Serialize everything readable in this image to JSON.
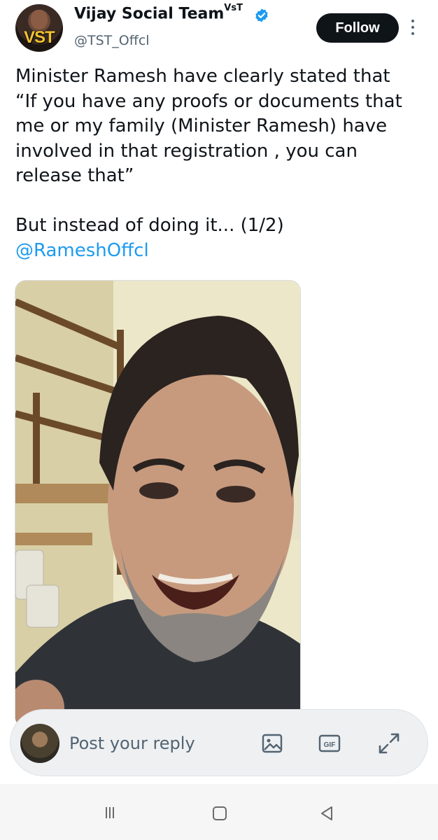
{
  "author": {
    "display_name": "Vijay Social Team",
    "name_superscript": "VsT",
    "handle": "@TST_Offcl",
    "avatar_text": "VST",
    "verified": true
  },
  "actions": {
    "follow_label": "Follow"
  },
  "tweet": {
    "lines": [
      "Minister Ramesh have clearly stated that",
      "“If you have any proofs or documents that",
      "me or my family (Minister Ramesh) have",
      "involved in that registration , you can",
      "release that”"
    ],
    "second_paragraph": "But instead of doing it... (1/2)",
    "mention": "@RameshOffcl"
  },
  "media": {
    "type": "video",
    "description_icon": "person-photo"
  },
  "reply": {
    "placeholder": "Post your reply"
  },
  "colors": {
    "link": "#1d9bf0",
    "verified_badge": "#1d9bf0",
    "follow_bg": "#0f1419",
    "secondary_text": "#536471"
  },
  "icons": {
    "verified": "verified-badge-icon",
    "more": "more-vertical-icon",
    "image": "image-icon",
    "gif": "gif-icon",
    "expand": "expand-icon",
    "nav_menu": "recent-apps-icon",
    "nav_home": "home-square-icon",
    "nav_back": "back-triangle-icon"
  }
}
